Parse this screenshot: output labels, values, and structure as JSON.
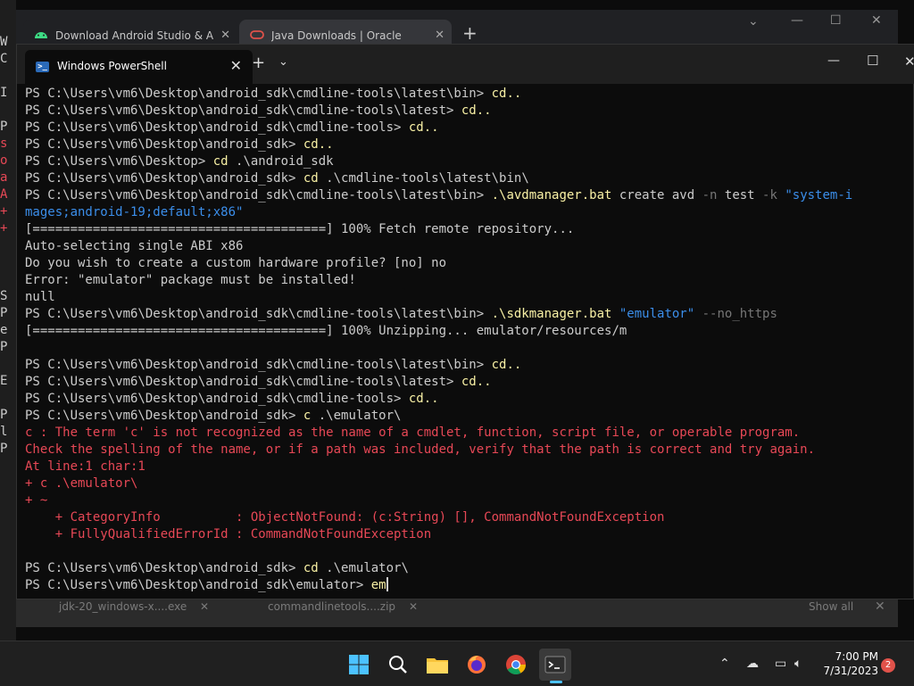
{
  "background_window": {
    "lines": [
      {
        "t": "W",
        "c": "w"
      },
      {
        "t": "C",
        "c": "w"
      },
      {
        "t": "",
        "c": "w"
      },
      {
        "t": "I",
        "c": "w"
      },
      {
        "t": "",
        "c": "w"
      },
      {
        "t": "P",
        "c": "w"
      },
      {
        "t": "s",
        "c": "r"
      },
      {
        "t": "o",
        "c": "r"
      },
      {
        "t": "a",
        "c": "r"
      },
      {
        "t": "A",
        "c": "r"
      },
      {
        "t": "+",
        "c": "r"
      },
      {
        "t": "+",
        "c": "r"
      },
      {
        "t": "",
        "c": "w"
      },
      {
        "t": "",
        "c": "w"
      },
      {
        "t": "",
        "c": "w"
      },
      {
        "t": "S",
        "c": "w"
      },
      {
        "t": "P",
        "c": "w"
      },
      {
        "t": "e",
        "c": "w"
      },
      {
        "t": "P",
        "c": "w"
      },
      {
        "t": "",
        "c": "w"
      },
      {
        "t": "E",
        "c": "w"
      },
      {
        "t": "",
        "c": "w"
      },
      {
        "t": "P",
        "c": "w"
      },
      {
        "t": "l",
        "c": "w"
      },
      {
        "t": "P",
        "c": "w"
      }
    ]
  },
  "chrome": {
    "tabs": [
      {
        "title": "Download Android Studio & App",
        "icon": "android-icon",
        "active": false
      },
      {
        "title": "Java Downloads | Oracle",
        "icon": "oracle-icon",
        "active": true
      }
    ],
    "new_tab_label": "+",
    "downloads": [
      {
        "name": "jdk-20_windows-x....exe"
      },
      {
        "name": "commandlinetools....zip"
      }
    ],
    "show_all_label": "Show all"
  },
  "terminal": {
    "tab_title": "Windows PowerShell",
    "new_tab_label": "+",
    "lines": [
      [
        {
          "t": "PS C:\\Users\\vm6\\Desktop\\android_sdk\\cmdline-tools\\latest\\bin> ",
          "s": "p"
        },
        {
          "t": "cd..",
          "s": "c"
        }
      ],
      [
        {
          "t": "PS C:\\Users\\vm6\\Desktop\\android_sdk\\cmdline-tools\\latest> ",
          "s": "p"
        },
        {
          "t": "cd..",
          "s": "c"
        }
      ],
      [
        {
          "t": "PS C:\\Users\\vm6\\Desktop\\android_sdk\\cmdline-tools> ",
          "s": "p"
        },
        {
          "t": "cd..",
          "s": "c"
        }
      ],
      [
        {
          "t": "PS C:\\Users\\vm6\\Desktop\\android_sdk> ",
          "s": "p"
        },
        {
          "t": "cd..",
          "s": "c"
        }
      ],
      [
        {
          "t": "PS C:\\Users\\vm6\\Desktop> ",
          "s": "p"
        },
        {
          "t": "cd ",
          "s": "c"
        },
        {
          "t": ".\\android_sdk",
          "s": "w"
        }
      ],
      [
        {
          "t": "PS C:\\Users\\vm6\\Desktop\\android_sdk> ",
          "s": "p"
        },
        {
          "t": "cd ",
          "s": "c"
        },
        {
          "t": ".\\cmdline-tools\\latest\\bin\\",
          "s": "w"
        }
      ],
      [
        {
          "t": "PS C:\\Users\\vm6\\Desktop\\android_sdk\\cmdline-tools\\latest\\bin> ",
          "s": "p"
        },
        {
          "t": ".\\avdmanager.bat",
          "s": "c"
        },
        {
          "t": " create avd ",
          "s": "w"
        },
        {
          "t": "-n",
          "s": "f"
        },
        {
          "t": " test ",
          "s": "w"
        },
        {
          "t": "-k",
          "s": "f"
        },
        {
          "t": " \"system-i",
          "s": "q"
        }
      ],
      [
        {
          "t": "mages;android-19;default;x86\"",
          "s": "q"
        }
      ],
      [
        {
          "t": "[=======================================] 100% Fetch remote repository...",
          "s": "w"
        }
      ],
      [
        {
          "t": "Auto-selecting single ABI x86",
          "s": "w"
        }
      ],
      [
        {
          "t": "Do you wish to create a custom hardware profile? [no] no",
          "s": "w"
        }
      ],
      [
        {
          "t": "Error: \"emulator\" package must be installed!",
          "s": "w"
        }
      ],
      [
        {
          "t": "null",
          "s": "w"
        }
      ],
      [
        {
          "t": "PS C:\\Users\\vm6\\Desktop\\android_sdk\\cmdline-tools\\latest\\bin> ",
          "s": "p"
        },
        {
          "t": ".\\sdkmanager.bat",
          "s": "c"
        },
        {
          "t": " \"emulator\"",
          "s": "q"
        },
        {
          "t": " --no_https",
          "s": "f"
        }
      ],
      [
        {
          "t": "[=======================================] 100% Unzipping... emulator/resources/m",
          "s": "w"
        }
      ],
      [
        {
          "t": "",
          "s": "w"
        }
      ],
      [
        {
          "t": "PS C:\\Users\\vm6\\Desktop\\android_sdk\\cmdline-tools\\latest\\bin> ",
          "s": "p"
        },
        {
          "t": "cd..",
          "s": "c"
        }
      ],
      [
        {
          "t": "PS C:\\Users\\vm6\\Desktop\\android_sdk\\cmdline-tools\\latest> ",
          "s": "p"
        },
        {
          "t": "cd..",
          "s": "c"
        }
      ],
      [
        {
          "t": "PS C:\\Users\\vm6\\Desktop\\android_sdk\\cmdline-tools> ",
          "s": "p"
        },
        {
          "t": "cd..",
          "s": "c"
        }
      ],
      [
        {
          "t": "PS C:\\Users\\vm6\\Desktop\\android_sdk> ",
          "s": "p"
        },
        {
          "t": "c ",
          "s": "c"
        },
        {
          "t": ".\\emulator\\",
          "s": "w"
        }
      ],
      [
        {
          "t": "c : The term 'c' is not recognized as the name of a cmdlet, function, script file, or operable program.",
          "s": "e"
        }
      ],
      [
        {
          "t": "Check the spelling of the name, or if a path was included, verify that the path is correct and try again.",
          "s": "e"
        }
      ],
      [
        {
          "t": "At line:1 char:1",
          "s": "e"
        }
      ],
      [
        {
          "t": "+ c .\\emulator\\",
          "s": "e"
        }
      ],
      [
        {
          "t": "+ ~",
          "s": "e"
        }
      ],
      [
        {
          "t": "    + CategoryInfo          : ObjectNotFound: (c:String) [], CommandNotFoundException",
          "s": "e"
        }
      ],
      [
        {
          "t": "    + FullyQualifiedErrorId : CommandNotFoundException",
          "s": "e"
        }
      ],
      [
        {
          "t": "",
          "s": "w"
        }
      ],
      [
        {
          "t": "PS C:\\Users\\vm6\\Desktop\\android_sdk> ",
          "s": "p"
        },
        {
          "t": "cd ",
          "s": "c"
        },
        {
          "t": ".\\emulator\\",
          "s": "w"
        }
      ],
      [
        {
          "t": "PS C:\\Users\\vm6\\Desktop\\android_sdk\\emulator> ",
          "s": "p"
        },
        {
          "t": "em",
          "s": "c"
        }
      ]
    ]
  },
  "taskbar": {
    "time": "7:00 PM",
    "date": "7/31/2023",
    "notification_count": "2"
  },
  "colors": {
    "prompt": "#cccccc",
    "command": "#f9f1a5",
    "string": "#3b8eea",
    "flag": "#767676",
    "error": "#e74856"
  }
}
